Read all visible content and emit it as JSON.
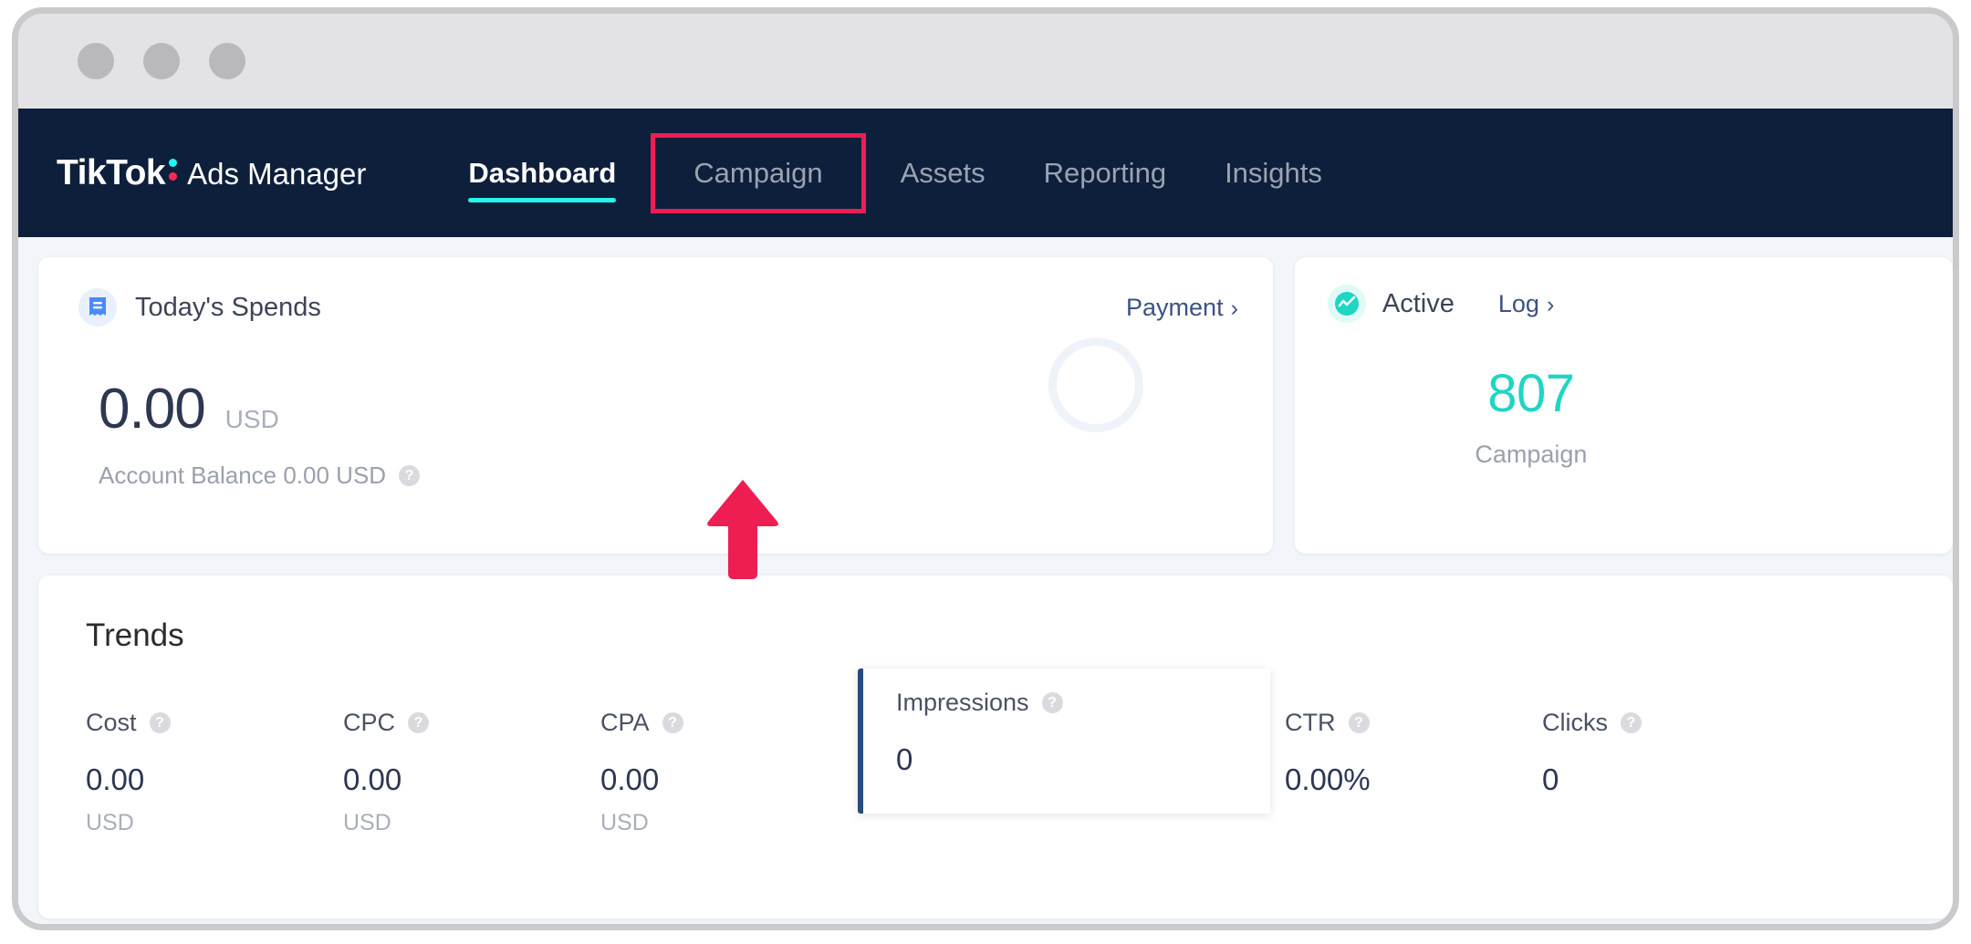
{
  "window": {
    "traffic_lights": [
      "close-dot",
      "minimize-dot",
      "maximize-dot"
    ]
  },
  "navbar": {
    "logo_primary": "TikTok",
    "logo_suffix": "Ads Manager",
    "items": [
      {
        "label": "Dashboard",
        "active": true
      },
      {
        "label": "Campaign",
        "active": false,
        "highlighted": true
      },
      {
        "label": "Assets",
        "active": false
      },
      {
        "label": "Reporting",
        "active": false
      },
      {
        "label": "Insights",
        "active": false
      }
    ],
    "colors": {
      "background": "#0e1f3c",
      "active_underline": "#25f4ee",
      "highlight_box": "#ee1d52",
      "inactive_text": "#9aa3b0"
    }
  },
  "annotation": {
    "arrow_color": "#ee1d52",
    "points_to": "Campaign"
  },
  "spends_card": {
    "icon": "receipt-icon",
    "title": "Today's Spends",
    "payment_link": "Payment",
    "chevron": "›",
    "value": "0.00",
    "unit": "USD",
    "balance_text": "Account Balance 0.00 USD",
    "help_glyph": "?"
  },
  "status_card": {
    "icon": "pulse-icon",
    "status_label": "Active",
    "log_link": "Log",
    "chevron": "›",
    "count": "807",
    "caption": "Campaign",
    "count_color": "#20d5c4"
  },
  "trends": {
    "title": "Trends",
    "help_glyph": "?",
    "metrics": [
      {
        "label": "Cost",
        "value": "0.00",
        "unit": "USD",
        "selected": false
      },
      {
        "label": "CPC",
        "value": "0.00",
        "unit": "USD",
        "selected": false
      },
      {
        "label": "CPA",
        "value": "0.00",
        "unit": "USD",
        "selected": false
      },
      {
        "label": "Impressions",
        "value": "0",
        "unit": "",
        "selected": true
      },
      {
        "label": "CTR",
        "value": "0.00%",
        "unit": "",
        "selected": false
      },
      {
        "label": "Clicks",
        "value": "0",
        "unit": "",
        "selected": false
      }
    ]
  }
}
